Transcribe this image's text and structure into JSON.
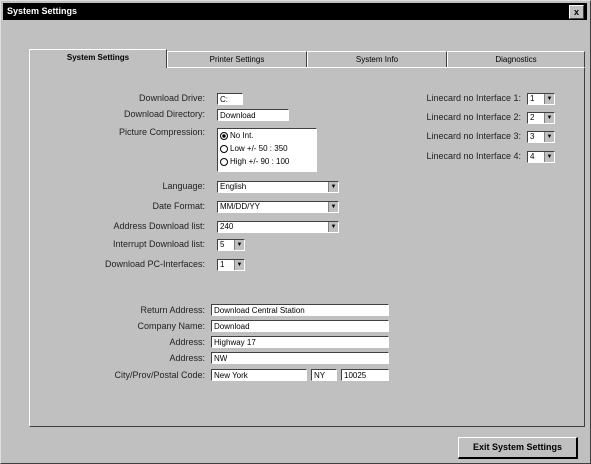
{
  "window": {
    "title": "System Settings",
    "close_label": "x"
  },
  "tabs": [
    "System Settings",
    "Printer Settings",
    "System Info",
    "Diagnostics"
  ],
  "settings": {
    "download_drive": {
      "label": "Download Drive:",
      "value": "C:"
    },
    "download_directory": {
      "label": "Download Directory:",
      "value": "Download"
    },
    "picture_compression": {
      "label": "Picture Compression:",
      "options": [
        "No Int.",
        "Low +/- 50 : 350",
        "High +/- 90 : 100"
      ],
      "selected_index": 0
    },
    "language": {
      "label": "Language:",
      "value": "English"
    },
    "date_format": {
      "label": "Date Format:",
      "value": "MM/DD/YY"
    },
    "address_download_list": {
      "label": "Address Download list:",
      "value": "240"
    },
    "interrupt_download_list": {
      "label": "Interrupt Download list:",
      "value": "5"
    },
    "download_pc_interfaces": {
      "label": "Download PC-Interfaces:",
      "value": "1"
    }
  },
  "linecards": [
    {
      "label": "Linecard no Interface 1:",
      "value": "1"
    },
    {
      "label": "Linecard no Interface 2:",
      "value": "2"
    },
    {
      "label": "Linecard no Interface 3:",
      "value": "3"
    },
    {
      "label": "Linecard no Interface 4:",
      "value": "4"
    }
  ],
  "return": {
    "return_address": {
      "label": "Return Address:",
      "value": "Download Central Station"
    },
    "company_name": {
      "label": "Company Name:",
      "value": "Download"
    },
    "address1": {
      "label": "Address:",
      "value": "Highway 17"
    },
    "address2": {
      "label": "Address:",
      "value": "NW"
    },
    "city": {
      "label": "City/Prov/Postal Code:",
      "value": "New York",
      "prov": "NY",
      "postal": "10025"
    }
  },
  "footer": {
    "exit_label": "Exit System Settings"
  },
  "icons": {
    "dropdown": "dropdown-arrow-icon",
    "close": "close-icon"
  }
}
